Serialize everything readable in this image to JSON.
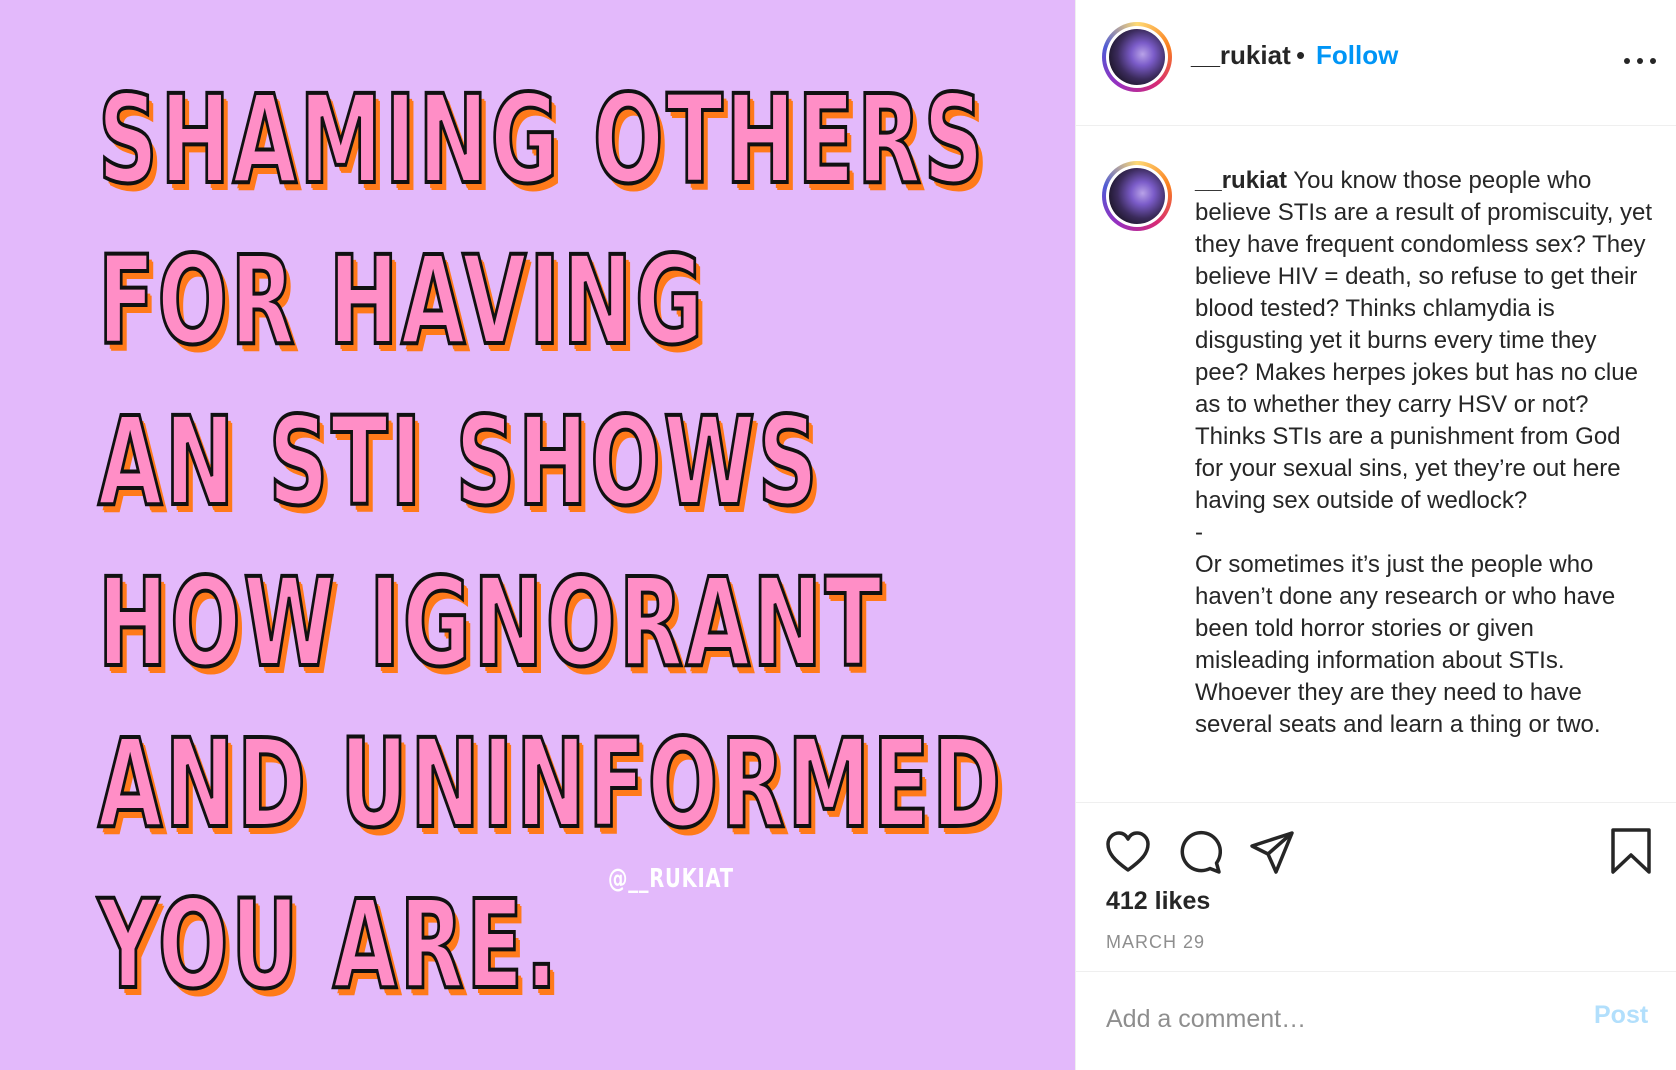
{
  "post_image": {
    "headline_lines": [
      "SHAMING OTHERS",
      "FOR HAVING",
      "AN STI SHOWS",
      "HOW IGNORANT",
      "AND UNINFORMED",
      "YOU ARE."
    ],
    "watermark": "@__RUKIAT",
    "background_color": "#e3b9fb",
    "text_color": "#ff8ec6",
    "shadow_color": "#ff7a1a"
  },
  "header": {
    "username": "__rukiat",
    "separator": "•",
    "follow_label": "Follow",
    "more_icon": "more-horizontal-icon"
  },
  "caption": {
    "username": "__rukiat",
    "paragraph_1": "You know those people who believe STIs are a result of promiscuity, yet they have frequent condomless sex? They believe HIV = death, so refuse to get their blood tested? Thinks chlamydia is disgusting yet it burns every time they pee? Makes herpes jokes but has no clue as to whether they carry HSV or not? Thinks STIs are a punishment from God for your sexual sins, yet they’re out here having sex outside of wedlock?",
    "divider": "-",
    "paragraph_2": "Or sometimes it’s just the people who haven’t done any research or who have been told horror stories or given misleading information about STIs. Whoever they are they need to have several seats and learn a thing or two."
  },
  "actions": {
    "icons": [
      "heart-icon",
      "comment-icon",
      "share-icon",
      "bookmark-icon"
    ],
    "likes": "412 likes",
    "date": "MARCH 29"
  },
  "comment": {
    "placeholder": "Add a comment…",
    "post_label": "Post"
  },
  "colors": {
    "link_blue": "#0095f6",
    "post_disabled": "#b2dffc",
    "muted": "#8e8e8e"
  }
}
